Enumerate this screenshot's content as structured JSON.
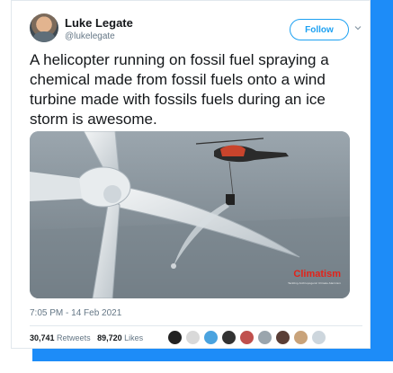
{
  "tweet": {
    "author_name": "Luke Legate",
    "author_handle": "@lukelegate",
    "follow_label": "Follow",
    "text": "A helicopter running on fossil fuel spraying a chemical made from fossil fuels onto a wind turbine made with fossils fuels during an ice storm is awesome.",
    "timestamp": "7:05 PM - 14 Feb 2021",
    "retweets_count": "30,741",
    "retweets_label": "Retweets",
    "likes_count": "89,720",
    "likes_label": "Likes"
  },
  "media": {
    "watermark": "Climatism",
    "watermark_sub": "Tackling Anthropogenic Climate Alarmism"
  },
  "colors": {
    "accent": "#1da1f2",
    "frame": "#1d8cf8",
    "watermark": "#e2231a"
  },
  "likers": [
    {
      "icon": "avatar-black-circle",
      "color": "#222222"
    },
    {
      "icon": "avatar-figure",
      "color": "#d9d9d9"
    },
    {
      "icon": "avatar-blue",
      "color": "#4aa3df"
    },
    {
      "icon": "avatar-bird",
      "color": "#333333"
    },
    {
      "icon": "avatar-person",
      "color": "#c0504d"
    },
    {
      "icon": "avatar-gray",
      "color": "#9aa5ad"
    },
    {
      "icon": "avatar-dark",
      "color": "#5a3e36"
    },
    {
      "icon": "avatar-sand",
      "color": "#c9a37a"
    },
    {
      "icon": "avatar-light",
      "color": "#cdd6dd"
    }
  ]
}
